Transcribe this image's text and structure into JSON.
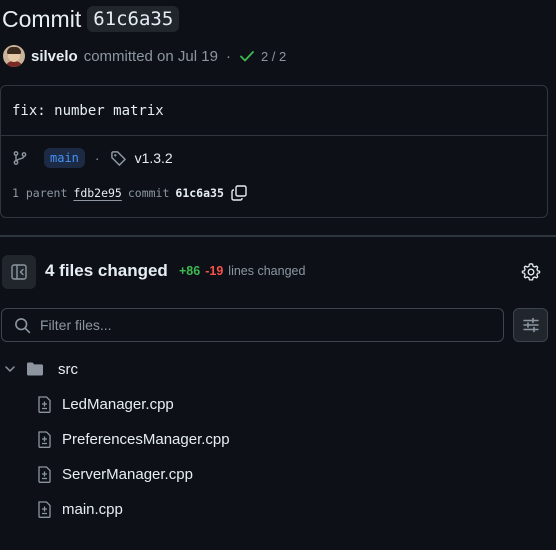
{
  "header": {
    "title": "Commit",
    "sha": "61c6a35"
  },
  "author_row": {
    "author": "silvelo",
    "action": "committed on Jul 19",
    "separator": "·",
    "checks": "2 / 2"
  },
  "commit": {
    "message": "fix: number matrix",
    "branch": "main",
    "separator": "·",
    "tag": "v1.3.2",
    "parent_label": "1 parent",
    "parent_sha": "fdb2e95",
    "commit_label": "commit",
    "commit_sha": "61c6a35"
  },
  "files_changed": {
    "title": "4 files changed",
    "additions": "+86",
    "deletions": "-19",
    "suffix": "lines changed"
  },
  "filter": {
    "placeholder": "Filter files..."
  },
  "tree": {
    "folder": "src",
    "files": [
      "LedManager.cpp",
      "PreferencesManager.cpp",
      "ServerManager.cpp",
      "main.cpp"
    ]
  },
  "colors": {
    "background": "#0d1117",
    "border": "#30363d",
    "accent_blue": "#4493f8",
    "success_green": "#3fb950",
    "danger_red": "#f85149",
    "muted": "#8d96a0"
  },
  "icons": {
    "branch": "git-branch-icon",
    "tag": "tag-icon",
    "copy": "copy-icon",
    "check": "check-icon",
    "panel": "sidebar-collapse-icon",
    "settings": "gear-icon",
    "search": "search-icon",
    "filter": "filter-options-icon",
    "chevron": "chevron-down-icon",
    "folder": "folder-icon",
    "file": "file-diff-icon"
  }
}
